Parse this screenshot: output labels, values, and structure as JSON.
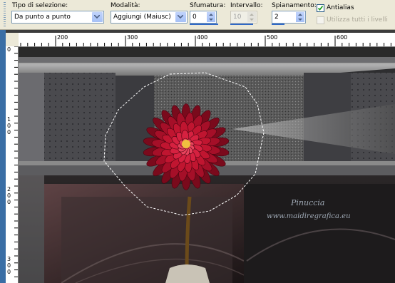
{
  "toolbar": {
    "selection_type": {
      "label": "Tipo di selezione:",
      "value": "Da punto a punto"
    },
    "mode": {
      "label": "Modalità:",
      "value": "Aggiungi (Maiusc)"
    },
    "feather": {
      "label": "Sfumatura:",
      "value": "0"
    },
    "range": {
      "label": "Intervallo:",
      "value": "10"
    },
    "smoothing": {
      "label": "Spianamento:",
      "value": "2"
    },
    "antialias": {
      "label": "Antialias",
      "checked": true
    },
    "all_layers": {
      "label": "Utilizza tutti i livelli",
      "checked": false
    }
  },
  "rulers": {
    "horizontal_labels": [
      "200",
      "300",
      "400",
      "500",
      "600"
    ],
    "vertical_labels": [
      "0",
      "1\n0\n0",
      "2\n0\n0",
      "3\n0\n0"
    ]
  },
  "canvas": {
    "watermark_name": "Pinuccia",
    "watermark_site": "www.maidiregrafica.eu"
  },
  "colors": {
    "toolbar_bg": "#ece9d8",
    "field_border": "#7f9db9",
    "flower_red": "#b0102a",
    "side_pane": "#3a6ea5"
  },
  "icons": {
    "dropdown": "chevron-down-icon",
    "spinner": "up-down-arrows-icon",
    "checkbox": "checkmark-icon"
  }
}
